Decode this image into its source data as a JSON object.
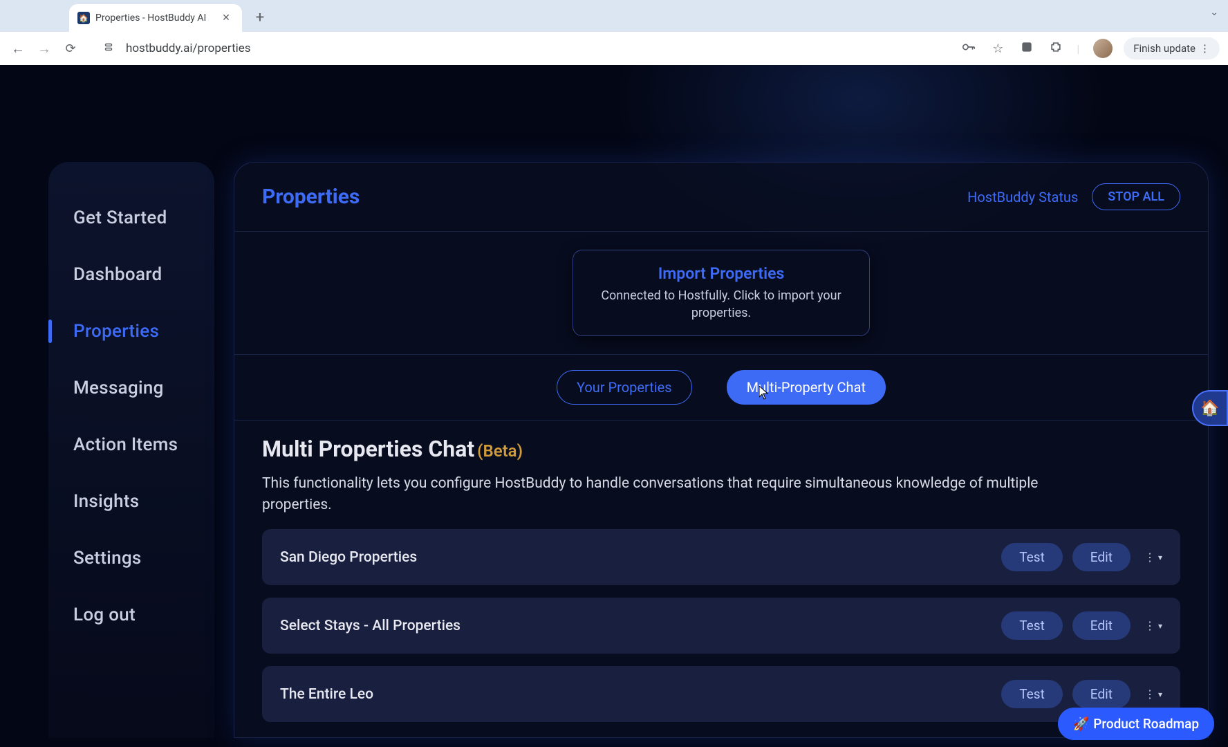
{
  "browser": {
    "tab_title": "Properties - HostBuddy AI",
    "url": "hostbuddy.ai/properties",
    "finish_update": "Finish update"
  },
  "sidebar": {
    "items": [
      {
        "label": "Get Started",
        "active": false
      },
      {
        "label": "Dashboard",
        "active": false
      },
      {
        "label": "Properties",
        "active": true
      },
      {
        "label": "Messaging",
        "active": false
      },
      {
        "label": "Action Items",
        "active": false
      },
      {
        "label": "Insights",
        "active": false
      },
      {
        "label": "Settings",
        "active": false
      },
      {
        "label": "Log out",
        "active": false
      }
    ]
  },
  "header": {
    "title": "Properties",
    "status_label": "HostBuddy Status",
    "stop_all": "STOP ALL"
  },
  "import_card": {
    "title": "Import Properties",
    "desc": "Connected to Hostfully. Click to import your properties."
  },
  "tabs": {
    "your_properties": "Your Properties",
    "multi_property_chat": "Multi-Property Chat"
  },
  "multi_chat": {
    "heading": "Multi Properties Chat",
    "beta": "(Beta)",
    "desc": "This functionality lets you configure HostBuddy to handle conversations that require simultaneous knowledge of multiple properties."
  },
  "rows": [
    {
      "name": "San Diego Properties",
      "test": "Test",
      "edit": "Edit"
    },
    {
      "name": "Select Stays - All Properties",
      "test": "Test",
      "edit": "Edit"
    },
    {
      "name": "The Entire Leo",
      "test": "Test",
      "edit": "Edit"
    }
  ],
  "roadmap_label": "Product Roadmap"
}
